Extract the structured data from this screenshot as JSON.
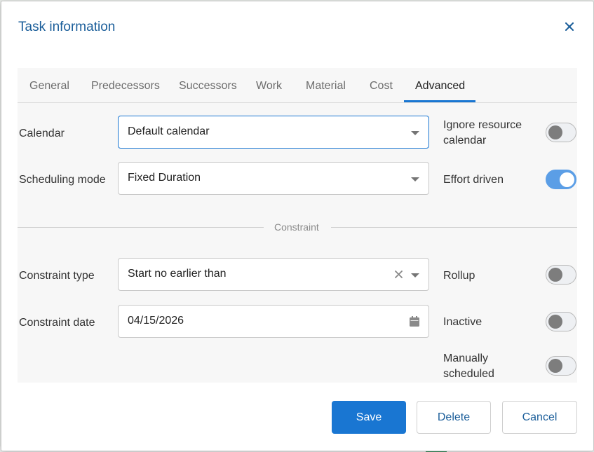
{
  "dialog": {
    "title": "Task information"
  },
  "tabs": [
    {
      "label": "General"
    },
    {
      "label": "Predecessors"
    },
    {
      "label": "Successors"
    },
    {
      "label": "Work"
    },
    {
      "label": "Material"
    },
    {
      "label": "Cost"
    },
    {
      "label": "Advanced",
      "active": true
    }
  ],
  "fields": {
    "calendar": {
      "label": "Calendar",
      "value": "Default calendar"
    },
    "scheduling_mode": {
      "label": "Scheduling mode",
      "value": "Fixed Duration"
    },
    "constraint_type": {
      "label": "Constraint type",
      "value": "Start no earlier than"
    },
    "constraint_date": {
      "label": "Constraint date",
      "value": "04/15/2026"
    }
  },
  "toggles": {
    "ignore_resource_calendar": {
      "label_line1": "Ignore resource",
      "label_line2": "calendar",
      "checked": false
    },
    "effort_driven": {
      "label": "Effort driven",
      "checked": true
    },
    "rollup": {
      "label": "Rollup",
      "checked": false
    },
    "inactive": {
      "label": "Inactive",
      "checked": false
    },
    "manually_scheduled": {
      "label_line1": "Manually",
      "label_line2": "scheduled",
      "checked": false
    }
  },
  "section": {
    "constraint_heading": "Constraint"
  },
  "buttons": {
    "save": "Save",
    "delete": "Delete",
    "cancel": "Cancel"
  },
  "colors": {
    "accent": "#1976d2",
    "title": "#1b5e9a",
    "panel": "#f7f7f7"
  },
  "icons": {
    "close": "close-icon",
    "dropdown": "chevron-down-icon",
    "clear": "clear-icon",
    "calendar": "calendar-icon"
  }
}
